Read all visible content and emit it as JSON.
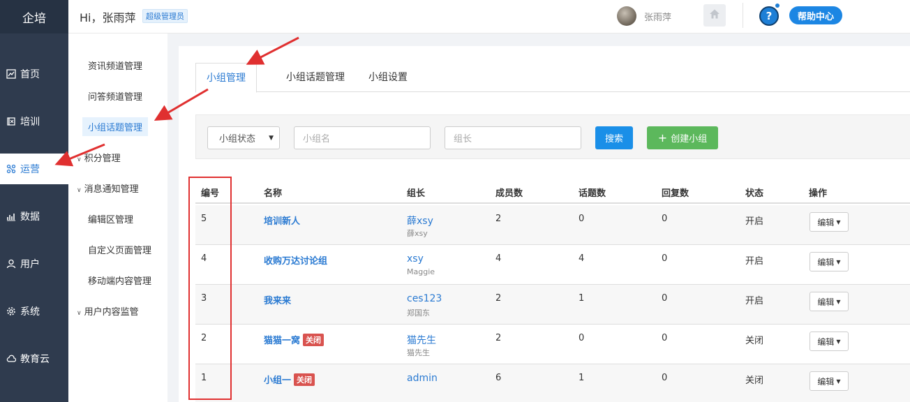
{
  "nav": {
    "logo": "企培",
    "items": [
      {
        "label": "首页",
        "icon": "chart-line-icon"
      },
      {
        "label": "培训",
        "icon": "book-icon"
      },
      {
        "label": "运营",
        "icon": "nodes-icon"
      },
      {
        "label": "数据",
        "icon": "bar-chart-icon"
      },
      {
        "label": "用户",
        "icon": "user-icon"
      },
      {
        "label": "系统",
        "icon": "gear-icon"
      },
      {
        "label": "教育云",
        "icon": "cloud-icon"
      }
    ],
    "active_index": 2
  },
  "header": {
    "greeting": "Hi，张雨萍",
    "role_badge": "超级管理员",
    "user_name": "张雨萍",
    "help_center": "帮助中心",
    "help_icon_text": "?"
  },
  "submenu": {
    "items": [
      {
        "label": "资讯频道管理"
      },
      {
        "label": "问答频道管理"
      },
      {
        "label": "小组话题管理"
      },
      {
        "label": "积分管理"
      },
      {
        "label": "消息通知管理"
      },
      {
        "label": "编辑区管理"
      },
      {
        "label": "自定义页面管理"
      },
      {
        "label": "移动端内容管理"
      },
      {
        "label": "用户内容监管"
      }
    ]
  },
  "tabs": [
    {
      "label": "小组管理"
    },
    {
      "label": "小组话题管理"
    },
    {
      "label": "小组设置"
    }
  ],
  "filter": {
    "status_select": "小组状态",
    "group_name_placeholder": "小组名",
    "leader_placeholder": "组长",
    "search_label": "搜索",
    "create_label": "创建小组"
  },
  "table": {
    "headers": [
      "编号",
      "名称",
      "组长",
      "成员数",
      "话题数",
      "回复数",
      "状态",
      "操作"
    ],
    "closed_tag": "关闭",
    "edit_label": "编辑",
    "rows": [
      {
        "id": "5",
        "name": "培训新人",
        "closed": false,
        "leader": "薛xsy",
        "leader_sub": "薛xsy",
        "members": "2",
        "topics": "0",
        "replies": "0",
        "status": "开启"
      },
      {
        "id": "4",
        "name": "收购万达讨论组",
        "closed": false,
        "leader": "xsy",
        "leader_sub": "Maggie",
        "members": "4",
        "topics": "4",
        "replies": "0",
        "status": "开启"
      },
      {
        "id": "3",
        "name": "我来来",
        "closed": false,
        "leader": "ces123",
        "leader_sub": "郑国东",
        "members": "2",
        "topics": "1",
        "replies": "0",
        "status": "开启"
      },
      {
        "id": "2",
        "name": "猫猫一窝",
        "closed": true,
        "leader": "猫先生",
        "leader_sub": "猫先生",
        "members": "2",
        "topics": "0",
        "replies": "0",
        "status": "关闭"
      },
      {
        "id": "1",
        "name": "小组一",
        "closed": true,
        "leader": "admin",
        "leader_sub": "",
        "members": "6",
        "topics": "1",
        "replies": "0",
        "status": "关闭"
      }
    ]
  },
  "colors": {
    "nav_bg": "#2f3b4e",
    "accent": "#2a7ad2",
    "search_btn": "#1a8fe8",
    "create_btn": "#5cb85c",
    "closed_tag": "#d9534f",
    "annotation": "#e03030"
  }
}
